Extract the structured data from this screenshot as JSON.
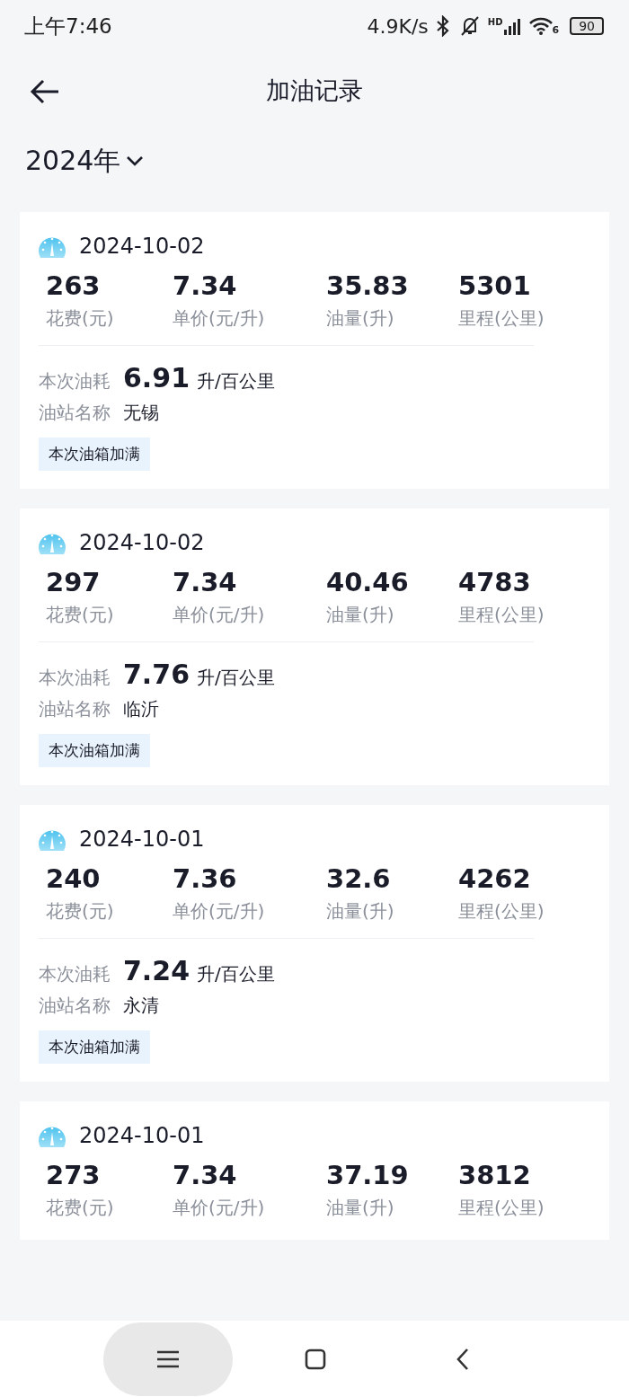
{
  "status_bar": {
    "time": "上午7:46",
    "network_speed": "4.9K/s",
    "signal_label": "HD",
    "wifi_label": "6",
    "battery": "90"
  },
  "header": {
    "title": "加油记录"
  },
  "year_selector": {
    "label": "2024年"
  },
  "records": [
    {
      "date": "2024-10-02",
      "stats": [
        {
          "value": "263",
          "label": "花费(元)"
        },
        {
          "value": "7.34",
          "label": "单价(元/升)"
        },
        {
          "value": "35.83",
          "label": "油量(升)"
        },
        {
          "value": "5301",
          "label": "里程(公里)"
        }
      ],
      "consumption_label": "本次油耗",
      "consumption_value": "6.91",
      "consumption_unit": "升/百公里",
      "station_label": "油站名称",
      "station": "无锡",
      "tag": "本次油箱加满"
    },
    {
      "date": "2024-10-02",
      "stats": [
        {
          "value": "297",
          "label": "花费(元)"
        },
        {
          "value": "7.34",
          "label": "单价(元/升)"
        },
        {
          "value": "40.46",
          "label": "油量(升)"
        },
        {
          "value": "4783",
          "label": "里程(公里)"
        }
      ],
      "consumption_label": "本次油耗",
      "consumption_value": "7.76",
      "consumption_unit": "升/百公里",
      "station_label": "油站名称",
      "station": "临沂",
      "tag": "本次油箱加满"
    },
    {
      "date": "2024-10-01",
      "stats": [
        {
          "value": "240",
          "label": "花费(元)"
        },
        {
          "value": "7.36",
          "label": "单价(元/升)"
        },
        {
          "value": "32.6",
          "label": "油量(升)"
        },
        {
          "value": "4262",
          "label": "里程(公里)"
        }
      ],
      "consumption_label": "本次油耗",
      "consumption_value": "7.24",
      "consumption_unit": "升/百公里",
      "station_label": "油站名称",
      "station": "永清",
      "tag": "本次油箱加满"
    },
    {
      "date": "2024-10-01",
      "stats": [
        {
          "value": "273",
          "label": "花费(元)"
        },
        {
          "value": "7.34",
          "label": "单价(元/升)"
        },
        {
          "value": "37.19",
          "label": "油量(升)"
        },
        {
          "value": "3812",
          "label": "里程(公里)"
        }
      ]
    }
  ]
}
